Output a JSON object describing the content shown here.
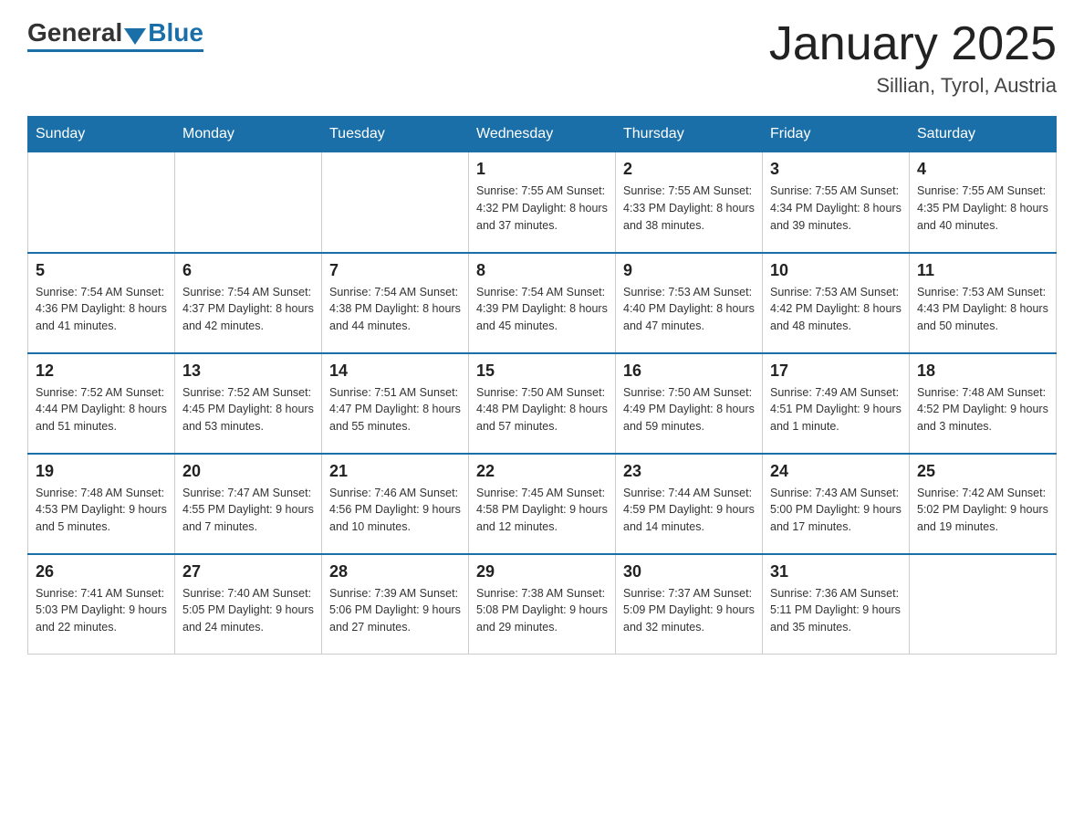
{
  "header": {
    "logo": {
      "general": "General",
      "blue": "Blue"
    },
    "title": "January 2025",
    "location": "Sillian, Tyrol, Austria"
  },
  "weekdays": [
    "Sunday",
    "Monday",
    "Tuesday",
    "Wednesday",
    "Thursday",
    "Friday",
    "Saturday"
  ],
  "weeks": [
    [
      {
        "day": "",
        "info": ""
      },
      {
        "day": "",
        "info": ""
      },
      {
        "day": "",
        "info": ""
      },
      {
        "day": "1",
        "info": "Sunrise: 7:55 AM\nSunset: 4:32 PM\nDaylight: 8 hours\nand 37 minutes."
      },
      {
        "day": "2",
        "info": "Sunrise: 7:55 AM\nSunset: 4:33 PM\nDaylight: 8 hours\nand 38 minutes."
      },
      {
        "day": "3",
        "info": "Sunrise: 7:55 AM\nSunset: 4:34 PM\nDaylight: 8 hours\nand 39 minutes."
      },
      {
        "day": "4",
        "info": "Sunrise: 7:55 AM\nSunset: 4:35 PM\nDaylight: 8 hours\nand 40 minutes."
      }
    ],
    [
      {
        "day": "5",
        "info": "Sunrise: 7:54 AM\nSunset: 4:36 PM\nDaylight: 8 hours\nand 41 minutes."
      },
      {
        "day": "6",
        "info": "Sunrise: 7:54 AM\nSunset: 4:37 PM\nDaylight: 8 hours\nand 42 minutes."
      },
      {
        "day": "7",
        "info": "Sunrise: 7:54 AM\nSunset: 4:38 PM\nDaylight: 8 hours\nand 44 minutes."
      },
      {
        "day": "8",
        "info": "Sunrise: 7:54 AM\nSunset: 4:39 PM\nDaylight: 8 hours\nand 45 minutes."
      },
      {
        "day": "9",
        "info": "Sunrise: 7:53 AM\nSunset: 4:40 PM\nDaylight: 8 hours\nand 47 minutes."
      },
      {
        "day": "10",
        "info": "Sunrise: 7:53 AM\nSunset: 4:42 PM\nDaylight: 8 hours\nand 48 minutes."
      },
      {
        "day": "11",
        "info": "Sunrise: 7:53 AM\nSunset: 4:43 PM\nDaylight: 8 hours\nand 50 minutes."
      }
    ],
    [
      {
        "day": "12",
        "info": "Sunrise: 7:52 AM\nSunset: 4:44 PM\nDaylight: 8 hours\nand 51 minutes."
      },
      {
        "day": "13",
        "info": "Sunrise: 7:52 AM\nSunset: 4:45 PM\nDaylight: 8 hours\nand 53 minutes."
      },
      {
        "day": "14",
        "info": "Sunrise: 7:51 AM\nSunset: 4:47 PM\nDaylight: 8 hours\nand 55 minutes."
      },
      {
        "day": "15",
        "info": "Sunrise: 7:50 AM\nSunset: 4:48 PM\nDaylight: 8 hours\nand 57 minutes."
      },
      {
        "day": "16",
        "info": "Sunrise: 7:50 AM\nSunset: 4:49 PM\nDaylight: 8 hours\nand 59 minutes."
      },
      {
        "day": "17",
        "info": "Sunrise: 7:49 AM\nSunset: 4:51 PM\nDaylight: 9 hours\nand 1 minute."
      },
      {
        "day": "18",
        "info": "Sunrise: 7:48 AM\nSunset: 4:52 PM\nDaylight: 9 hours\nand 3 minutes."
      }
    ],
    [
      {
        "day": "19",
        "info": "Sunrise: 7:48 AM\nSunset: 4:53 PM\nDaylight: 9 hours\nand 5 minutes."
      },
      {
        "day": "20",
        "info": "Sunrise: 7:47 AM\nSunset: 4:55 PM\nDaylight: 9 hours\nand 7 minutes."
      },
      {
        "day": "21",
        "info": "Sunrise: 7:46 AM\nSunset: 4:56 PM\nDaylight: 9 hours\nand 10 minutes."
      },
      {
        "day": "22",
        "info": "Sunrise: 7:45 AM\nSunset: 4:58 PM\nDaylight: 9 hours\nand 12 minutes."
      },
      {
        "day": "23",
        "info": "Sunrise: 7:44 AM\nSunset: 4:59 PM\nDaylight: 9 hours\nand 14 minutes."
      },
      {
        "day": "24",
        "info": "Sunrise: 7:43 AM\nSunset: 5:00 PM\nDaylight: 9 hours\nand 17 minutes."
      },
      {
        "day": "25",
        "info": "Sunrise: 7:42 AM\nSunset: 5:02 PM\nDaylight: 9 hours\nand 19 minutes."
      }
    ],
    [
      {
        "day": "26",
        "info": "Sunrise: 7:41 AM\nSunset: 5:03 PM\nDaylight: 9 hours\nand 22 minutes."
      },
      {
        "day": "27",
        "info": "Sunrise: 7:40 AM\nSunset: 5:05 PM\nDaylight: 9 hours\nand 24 minutes."
      },
      {
        "day": "28",
        "info": "Sunrise: 7:39 AM\nSunset: 5:06 PM\nDaylight: 9 hours\nand 27 minutes."
      },
      {
        "day": "29",
        "info": "Sunrise: 7:38 AM\nSunset: 5:08 PM\nDaylight: 9 hours\nand 29 minutes."
      },
      {
        "day": "30",
        "info": "Sunrise: 7:37 AM\nSunset: 5:09 PM\nDaylight: 9 hours\nand 32 minutes."
      },
      {
        "day": "31",
        "info": "Sunrise: 7:36 AM\nSunset: 5:11 PM\nDaylight: 9 hours\nand 35 minutes."
      },
      {
        "day": "",
        "info": ""
      }
    ]
  ]
}
